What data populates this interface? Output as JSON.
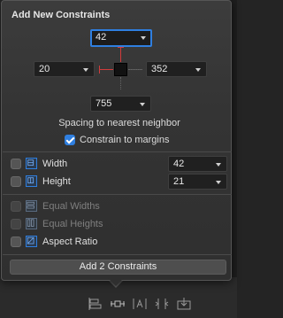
{
  "popover": {
    "title": "Add New Constraints",
    "top_value": "42",
    "left_value": "20",
    "right_value": "352",
    "bottom_value": "755",
    "spacing_label": "Spacing to nearest neighbor",
    "constrain_margins": {
      "label": "Constrain to margins",
      "checked": true
    }
  },
  "size_rows": [
    {
      "label": "Width",
      "value": "42",
      "checked": false
    },
    {
      "label": "Height",
      "value": "21",
      "checked": false
    }
  ],
  "equal_rows": [
    {
      "label": "Equal Widths",
      "enabled": false
    },
    {
      "label": "Equal Heights",
      "enabled": false
    },
    {
      "label": "Aspect Ratio",
      "enabled": true
    }
  ],
  "add_button_label": "Add 2 Constraints",
  "colors": {
    "accent": "#2f7fe0",
    "strut_red": "#d23b3b"
  },
  "bottom_toolbar_icons": [
    "align-icon",
    "pin-icon",
    "resolve-issues-icon",
    "resize-behavior-icon",
    "embed-in-icon"
  ]
}
